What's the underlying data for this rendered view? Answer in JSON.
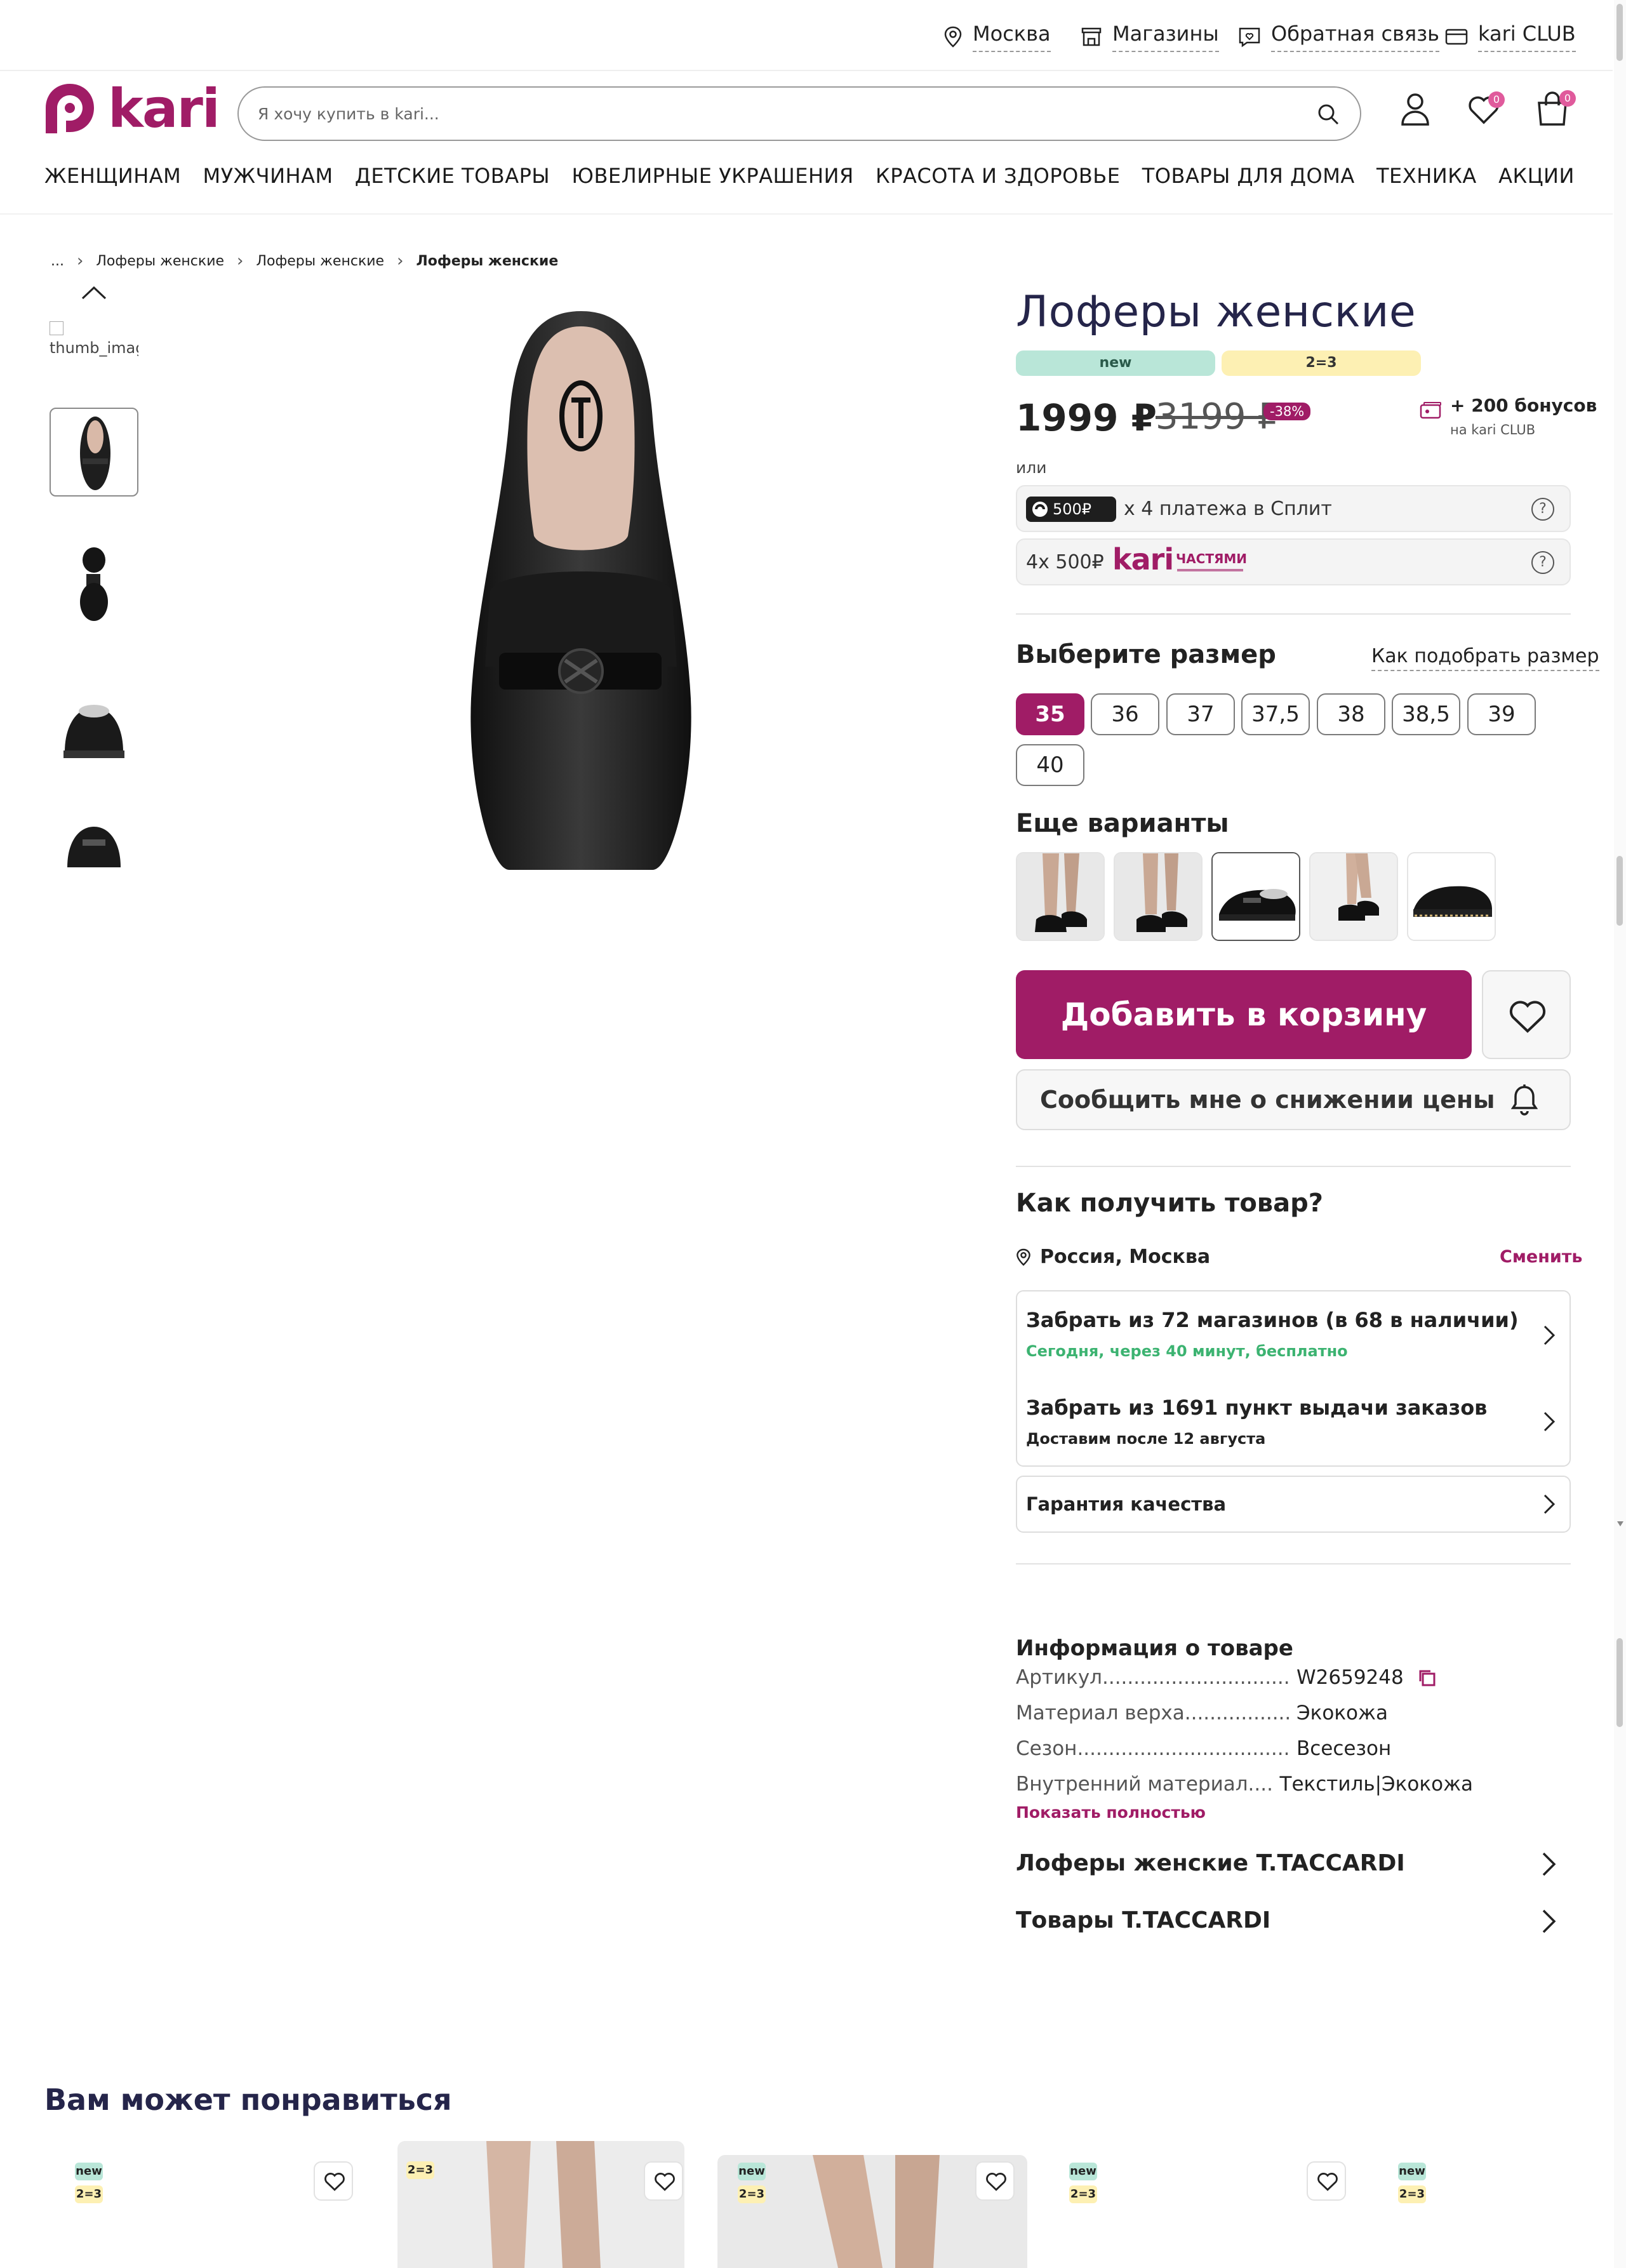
{
  "topbar": {
    "city": "Москва",
    "stores": "Магазины",
    "feedback": "Обратная связь",
    "club": "kari CLUB"
  },
  "header": {
    "logo_text": "kari",
    "search_placeholder": "Я хочу купить в kari...",
    "favorites_count": "0",
    "cart_count": "0"
  },
  "nav": [
    "ЖЕНЩИНАМ",
    "МУЖЧИНАМ",
    "ДЕТСКИЕ ТОВАРЫ",
    "ЮВЕЛИРНЫЕ УКРАШЕНИЯ",
    "КРАСОТА И ЗДОРОВЬЕ",
    "ТОВАРЫ ДЛЯ ДОМА",
    "ТЕХНИКА",
    "АКЦИИ"
  ],
  "breadcrumb": {
    "ellipsis": "...",
    "items": [
      "Лоферы женские",
      "Лоферы женские",
      "Лоферы женские"
    ]
  },
  "gallery": {
    "broken_thumb_alt": "thumb_image"
  },
  "product": {
    "title": "Лоферы женские",
    "tags": [
      "new",
      "2=3"
    ],
    "price": "1999 ₽",
    "old_price": "3199 ₽",
    "discount": "-38%",
    "bonus": "+ 200 бонусов",
    "bonus_sub": "на kari CLUB",
    "or": "или",
    "split": {
      "amount": "500₽",
      "text": "х 4 платежа в Сплит",
      "help": "?"
    },
    "kari_parts": {
      "text": "4x 500₽",
      "brand": "kari",
      "brand_sub": "ЧАСТЯМИ",
      "help": "?"
    },
    "choose_size": "Выберите размер",
    "how_size": "Как подобрать размер",
    "sizes": [
      "35",
      "36",
      "37",
      "37,5",
      "38",
      "38,5",
      "39",
      "40"
    ],
    "selected_size": "35",
    "more_variants": "Еще варианты",
    "add_to_cart": "Добавить в корзину",
    "notify_price": "Сообщить мне о снижении цены"
  },
  "delivery": {
    "title": "Как получить товар?",
    "location": "Россия, Москва",
    "change": "Сменить",
    "pickup_stores": "Забрать из 72 магазинов (в 68 в наличии)",
    "pickup_stores_sub": "Сегодня, через 40 минут, бесплатно",
    "pickup_points": "Забрать из 1691 пункт выдачи заказов",
    "pickup_points_sub": "Доставим после 12 августа",
    "guarantee": "Гарантия качества"
  },
  "info": {
    "title": "Информация о товаре",
    "rows": [
      {
        "k": "Артикул",
        "v": "W2659248"
      },
      {
        "k": "Материал верха",
        "v": "Экокожа"
      },
      {
        "k": "Сезон",
        "v": "Всесезон"
      },
      {
        "k": "Внутренний материал",
        "v": "Текстиль|Экокожа"
      }
    ],
    "show_all": "Показать полностью",
    "brand_link": "Лоферы женские T.TACCARDI",
    "brand_goods": "Товары T.TACCARDI"
  },
  "recommendations": {
    "title": "Вам может понравиться",
    "tag_new": "new",
    "tag_23": "2=3"
  },
  "colors": {
    "accent": "#a01c66",
    "tag_new": "#b9e6d8",
    "tag_23": "#fdf0b3",
    "title": "#25254a",
    "green": "#3cb371"
  }
}
